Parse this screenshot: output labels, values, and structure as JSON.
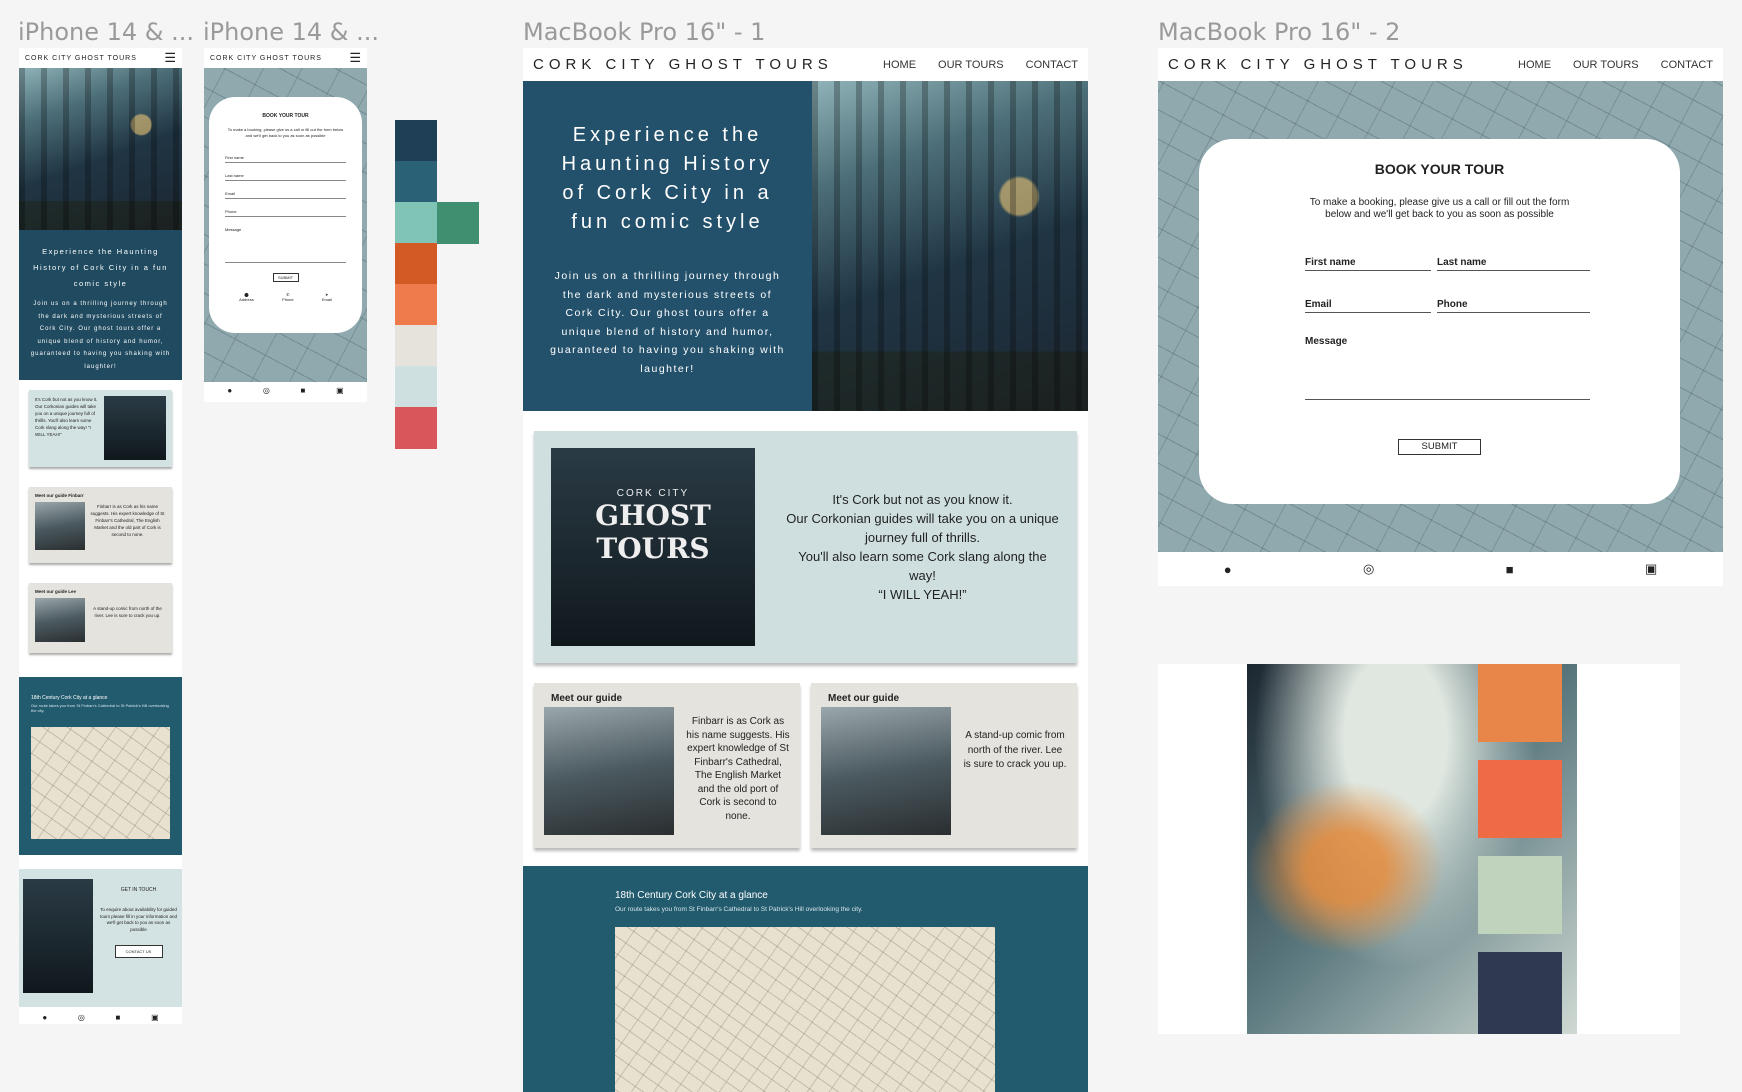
{
  "frames": {
    "iphone1": "iPhone 14 & ...",
    "iphone2": "iPhone 14 & ...",
    "mac1": "MacBook Pro 16\" - 1",
    "mac2": "MacBook Pro 16\" - 2"
  },
  "site": {
    "brand": "CORK CITY GHOST TOURS",
    "nav": [
      "HOME",
      "OUR TOURS",
      "CONTACT"
    ]
  },
  "hero": {
    "title": "Experience the Haunting History of Cork City in a fun comic style",
    "body": "Join us on a thrilling journey through the dark and mysterious streets of Cork City. Our ghost tours offer a unique blend of history and humor, guaranteed to having you shaking with laughter!"
  },
  "intro": {
    "lines": [
      "It's Cork but not as you know it.",
      "Our Corkonian guides will take you on a unique journey full of thrills.",
      "You'll also learn some Cork slang along the way!",
      "“I WILL YEAH!”"
    ],
    "poster_title": "GHOST TOURS",
    "poster_city": "CORK CITY"
  },
  "guides": [
    {
      "heading": "Meet our guide",
      "text": "Finbarr is as Cork as his name suggests. His expert knowledge of St Finbarr's Cathedral, The English Market and the old port of Cork is second to none."
    },
    {
      "heading": "Meet our guide",
      "text": "A stand-up comic from north of the river. Lee is sure to crack you up."
    }
  ],
  "mobile_guides": [
    {
      "heading": "Meet our guide Finbarr",
      "text": "Finbarr is as Cork as his name suggests. His expert knowledge of St Finbarr's Cathedral, The English Market and the old part of Cork is second to none."
    },
    {
      "heading": "Meet our guide Lee",
      "text": "A stand-up comic from north of the river. Lee is sure to crack you up."
    }
  ],
  "map_section": {
    "title": "18th Century Cork City at a glance",
    "subtitle": "Our route takes you from St Finbarr's Cathedral to St Patrick's Hill overlooking the city."
  },
  "booking": {
    "title": "BOOK YOUR TOUR",
    "intro": "To make a booking, please give us a call or fill out the form below and we'll get back to you as soon as possible",
    "first_name": "First name",
    "last_name": "Last name",
    "email": "Email",
    "phone": "Phone",
    "message": "Message",
    "submit": "SUBMIT"
  },
  "mobile_contact": {
    "title": "GET IN TOUCH",
    "text": "To enquire about availability for guided tours please fill in your information and we'll get back to you as soon as possible",
    "button": "CONTACT US",
    "address_label": "Address",
    "phone_label": "Phone",
    "email_label": "Email"
  },
  "social_icons": [
    "facebook-icon",
    "instagram-icon",
    "twitter-icon",
    "youtube-icon"
  ],
  "palette": [
    "#1f3f57",
    "#2b6176",
    "#7fc4b4",
    "#3f8f70",
    "#d35a24",
    "#ef7a4b",
    "#e6e3dc",
    "#cfe0e1",
    "#d9575b"
  ],
  "moodboard_swatches": [
    "#e8864a",
    "#ee6b45",
    "#bfd3bd",
    "#2f3952"
  ]
}
